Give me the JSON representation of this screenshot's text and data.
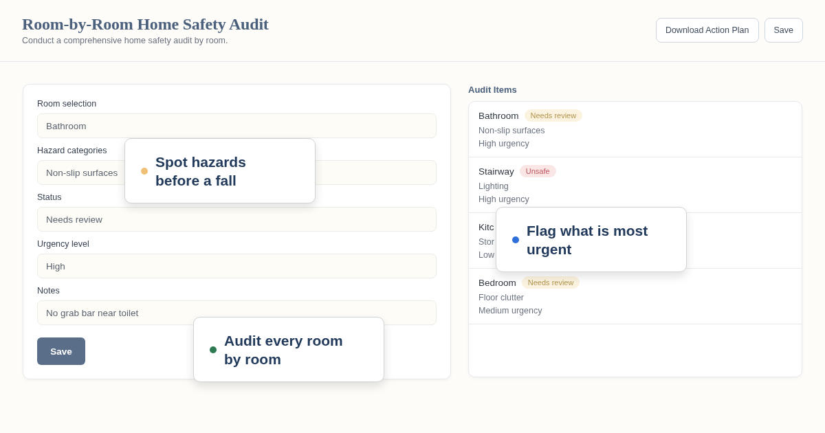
{
  "header": {
    "title": "Room-by-Room Home Safety Audit",
    "subtitle": "Conduct a comprehensive home safety audit by room.",
    "buttons": [
      "Download Action Plan",
      "Save"
    ]
  },
  "form": {
    "fields": [
      {
        "label": "Room selection",
        "value": "Bathroom"
      },
      {
        "label": "Hazard categories",
        "value": "Non-slip surfaces"
      },
      {
        "label": "Status",
        "value": "Needs review"
      },
      {
        "label": "Urgency level",
        "value": "High"
      },
      {
        "label": "Notes",
        "value": "No grab bar near toilet"
      }
    ],
    "submit": "Save"
  },
  "audit_items": {
    "title": "Audit Items",
    "items": [
      {
        "room": "Bathroom",
        "badge": {
          "label": "Needs review",
          "kind": "review"
        },
        "hazard": "Non-slip surfaces",
        "urgency": "High urgency"
      },
      {
        "room": "Stairway",
        "badge": {
          "label": "Unsafe",
          "kind": "unsafe"
        },
        "hazard": "Lighting",
        "urgency": "High urgency"
      },
      {
        "room": "Kitc",
        "hazard": "Stor",
        "urgency": "Low"
      },
      {
        "room": "Bedroom",
        "badge": {
          "label": "Needs review",
          "kind": "review"
        },
        "hazard": "Floor clutter",
        "urgency": "Medium urgency"
      }
    ]
  },
  "callouts": [
    {
      "text": "Spot hazards before a fall",
      "color": "#f0c078"
    },
    {
      "text": "Flag what is most urgent",
      "color": "#2f6fdc"
    },
    {
      "text": "Audit every room by room",
      "color": "#2e7a52"
    }
  ]
}
